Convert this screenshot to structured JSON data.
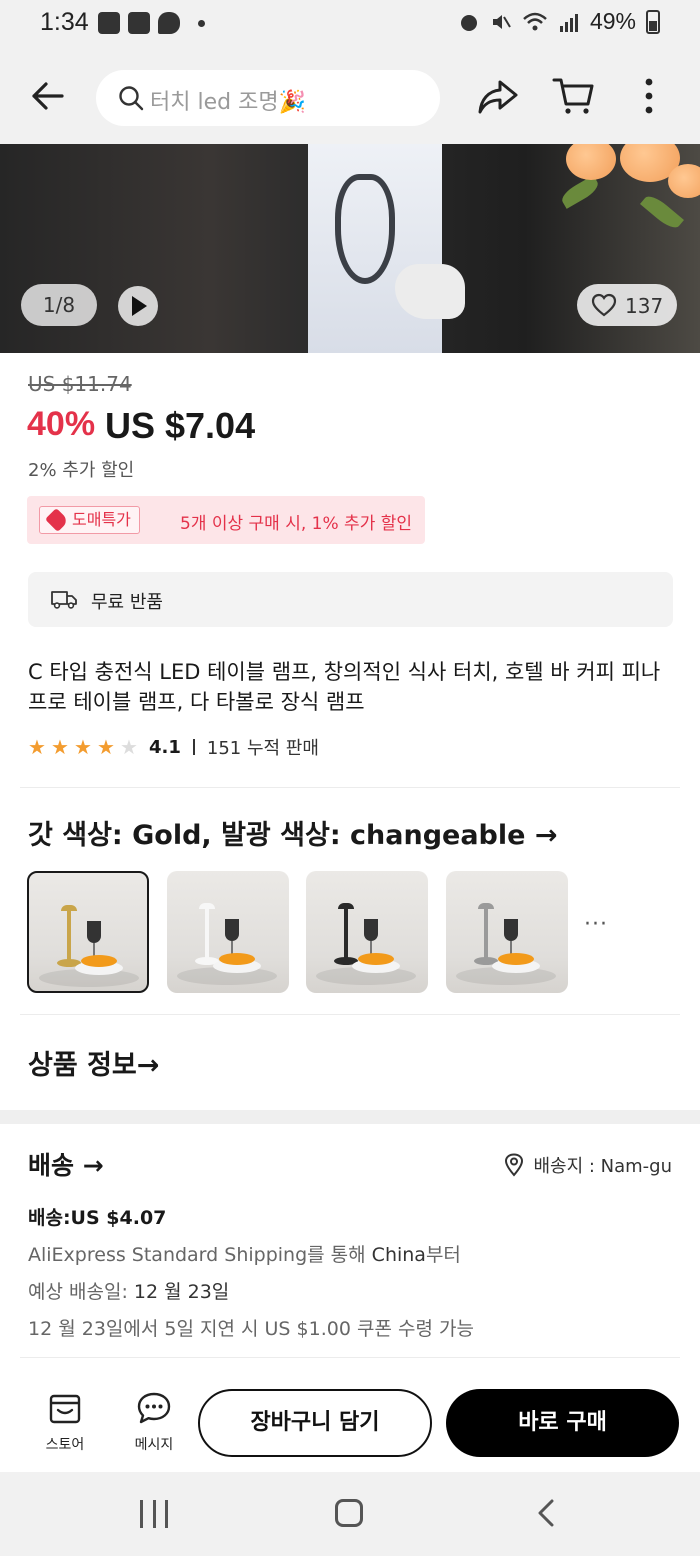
{
  "status_bar": {
    "time": "1:34",
    "battery": "49%"
  },
  "header": {
    "search_placeholder": "터치 led 조명🎉"
  },
  "gallery": {
    "counter": "1/8",
    "wishlist_count": "137"
  },
  "price": {
    "original": "US $11.74",
    "discount": "40%",
    "current": "US $7.04",
    "extra_discount": "2% 추가 할인"
  },
  "bulk_deal": {
    "tag": "도매특가",
    "text": "5개 이상 구매 시, 1% 추가 할인"
  },
  "returns": {
    "label": "무료 반품"
  },
  "product": {
    "title": "C 타입 충전식 LED 테이블 램프, 창의적인 식사 터치, 호텔 바 커피 피나 프로 테이블 램프, 다 타볼로 장식 램프",
    "rating": "4.1",
    "rating_value": 4.1,
    "sold": "151 누적 판매"
  },
  "variants": {
    "label": "갓 색상: Gold, 발광 색상: changeable →",
    "more": "···",
    "swatches": [
      {
        "name": "Gold",
        "color": "#c9a54a"
      },
      {
        "name": "White",
        "color": "#f7f7f7"
      },
      {
        "name": "Black",
        "color": "#2a2a2a"
      },
      {
        "name": "Grey",
        "color": "#9a9a9a"
      }
    ]
  },
  "product_info": {
    "label": "상품 정보→"
  },
  "shipping": {
    "title": "배송 →",
    "destination": "배송지 : Nam-gu",
    "price": "배송:US $4.07",
    "method_prefix": "AliExpress Standard Shipping를 통해 ",
    "method_origin": "China",
    "method_suffix": "부터",
    "eta_prefix": "예상 배송일: ",
    "eta_date": "12 월 23일",
    "delay": "12 월 23일에서 5일 지연 시 US $1.00 쿠폰 수령 가능"
  },
  "action_bar": {
    "store_label": "스토어",
    "message_label": "메시지",
    "add_to_cart": "장바구니 담기",
    "buy_now": "바로 구매"
  },
  "colors": {
    "accent_red": "#e4324a",
    "star": "#f39c2f",
    "buy_button": "#000000"
  }
}
